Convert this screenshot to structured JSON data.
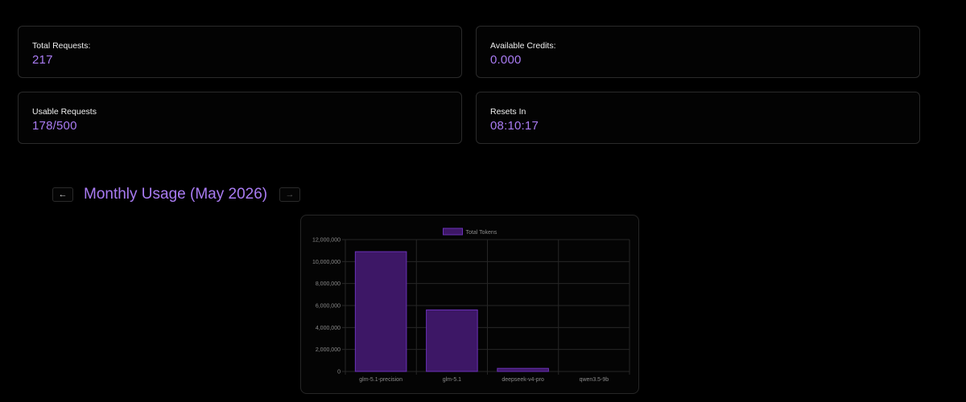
{
  "stats": {
    "total_requests": {
      "label": "Total Requests:",
      "value": "217"
    },
    "available_credits": {
      "label": "Available Credits:",
      "value": "0.000"
    },
    "usable_requests": {
      "label": "Usable Requests",
      "value": "178/500"
    },
    "resets_in": {
      "label": "Resets In",
      "value": "08:10:17"
    }
  },
  "monthly": {
    "title": "Monthly Usage (May 2026)",
    "prev_label": "←",
    "next_label": "→"
  },
  "colors": {
    "accent": "#a97bf2",
    "bar_fill": "#3d1766",
    "bar_stroke": "#6b32b8"
  },
  "chart_data": {
    "type": "bar",
    "categories": [
      "glm-5.1-precision",
      "glm-5.1",
      "deepseek-v4-pro",
      "qwen3.5-9b"
    ],
    "series": [
      {
        "name": "Total Tokens",
        "values": [
          10900000,
          5600000,
          280000,
          0
        ]
      }
    ],
    "ylim": [
      0,
      12000000
    ],
    "yticks": [
      "0",
      "2,000,000",
      "4,000,000",
      "6,000,000",
      "8,000,000",
      "10,000,000",
      "12,000,000"
    ],
    "grid": true,
    "legend": "top"
  }
}
